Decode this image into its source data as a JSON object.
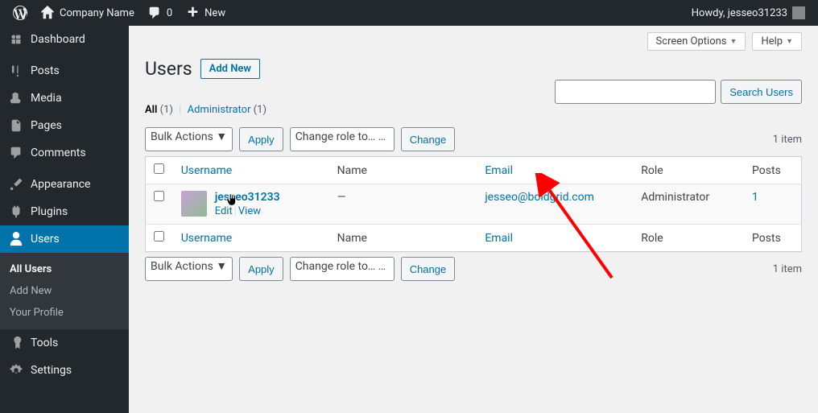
{
  "adminbar": {
    "site_name": "Company Name",
    "comments_count": "0",
    "new_label": "New",
    "howdy": "Howdy, jesseo31233"
  },
  "sidebar": {
    "dashboard": "Dashboard",
    "posts": "Posts",
    "media": "Media",
    "pages": "Pages",
    "comments": "Comments",
    "appearance": "Appearance",
    "plugins": "Plugins",
    "users": "Users",
    "tools": "Tools",
    "settings": "Settings",
    "submenu": {
      "all_users": "All Users",
      "add_new": "Add New",
      "your_profile": "Your Profile"
    }
  },
  "screen": {
    "options_label": "Screen Options",
    "help_label": "Help"
  },
  "page": {
    "title": "Users",
    "add_new": "Add New"
  },
  "filters": {
    "all_label": "All",
    "all_count": "(1)",
    "administrator_label": "Administrator",
    "administrator_count": "(1)"
  },
  "search": {
    "button": "Search Users"
  },
  "tablenav": {
    "bulk_label": "Bulk Actions",
    "apply": "Apply",
    "change_role_label": "Change role to…",
    "change": "Change",
    "item_count": "1 item"
  },
  "table": {
    "headers": {
      "username": "Username",
      "name": "Name",
      "email": "Email",
      "role": "Role",
      "posts": "Posts"
    },
    "user": {
      "username": "jesseo31233",
      "name": "—",
      "email": "jesseo@boldgrid.com",
      "role": "Administrator",
      "posts": "1",
      "edit": "Edit",
      "view": "View"
    }
  }
}
